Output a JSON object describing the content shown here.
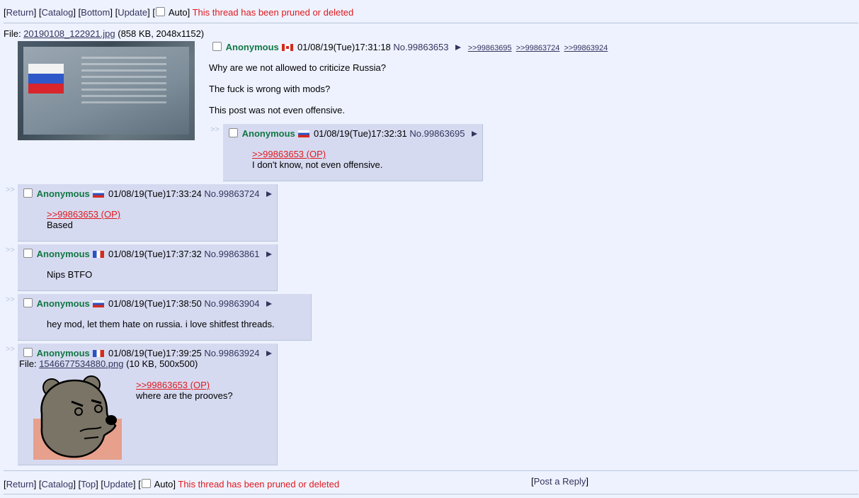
{
  "nav_top": {
    "return": "Return",
    "catalog": "Catalog",
    "bottom": "Bottom",
    "update": "Update",
    "auto": "Auto",
    "pruned": "This thread has been pruned or deleted"
  },
  "nav_bottom": {
    "return": "Return",
    "catalog": "Catalog",
    "top": "Top",
    "update": "Update",
    "auto": "Auto",
    "pruned": "This thread has been pruned or deleted",
    "post_reply": "Post a Reply"
  },
  "op": {
    "file_label": "File:",
    "file_name": "20190108_122921.jpg",
    "file_meta": "(858 KB, 2048x1152)",
    "name": "Anonymous",
    "flag": "flag-ca",
    "datetime": "01/08/19(Tue)17:31:18",
    "no_label": "No.",
    "no": "99863653",
    "backlinks": [
      ">>99863695",
      ">>99863724",
      ">>99863924"
    ],
    "lines": [
      "Why are we not allowed to criticize Russia?",
      "The fuck is wrong with mods?",
      "This post was not even offensive."
    ]
  },
  "replies": [
    {
      "name": "Anonymous",
      "flag": "flag-ru",
      "datetime": "01/08/19(Tue)17:32:31",
      "no": "99863695",
      "quote": ">>99863653 (OP)",
      "text": "I don't know, not even offensive."
    },
    {
      "name": "Anonymous",
      "flag": "flag-ru",
      "datetime": "01/08/19(Tue)17:33:24",
      "no": "99863724",
      "quote": ">>99863653 (OP)",
      "text": "Based"
    },
    {
      "name": "Anonymous",
      "flag": "flag-fr",
      "datetime": "01/08/19(Tue)17:37:32",
      "no": "99863861",
      "text": "Nips BTFO"
    },
    {
      "name": "Anonymous",
      "flag": "flag-ru",
      "datetime": "01/08/19(Tue)17:38:50",
      "no": "99863904",
      "text": "hey mod, let them hate on russia. i love shitfest threads."
    },
    {
      "name": "Anonymous",
      "flag": "flag-fr",
      "datetime": "01/08/19(Tue)17:39:25",
      "no": "99863924",
      "file_label": "File:",
      "file_name": "1546677534880.png",
      "file_meta": "(10 KB, 500x500)",
      "quote": ">>99863653 (OP)",
      "text": "where are the prooves?"
    }
  ],
  "colors": {
    "background": "#eef2ff",
    "reply_bg": "#d6daf0",
    "name": "#117743",
    "link": "#34345c",
    "quote_ref": "#e0191d",
    "pruned": "#e0191d"
  },
  "arrow_glyph": ">>"
}
